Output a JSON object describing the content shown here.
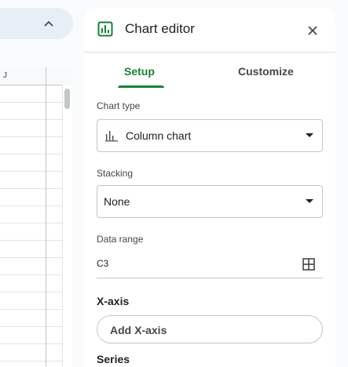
{
  "sheet": {
    "column_header": "J"
  },
  "editor": {
    "title": "Chart editor",
    "tabs": [
      {
        "label": "Setup",
        "active": true
      },
      {
        "label": "Customize",
        "active": false
      }
    ],
    "chart_type": {
      "label": "Chart type",
      "value": "Column chart",
      "icon": "column-chart-icon"
    },
    "stacking": {
      "label": "Stacking",
      "value": "None"
    },
    "data_range": {
      "label": "Data range",
      "value": "C3",
      "icon": "grid-icon"
    },
    "x_axis": {
      "heading": "X-axis",
      "button_label": "Add X-axis"
    },
    "series": {
      "heading": "Series"
    }
  },
  "colors": {
    "accent": "#188038",
    "border": "#c4c7c5",
    "panel_bg": "#ffffff",
    "page_bg": "#f9fbfd"
  }
}
